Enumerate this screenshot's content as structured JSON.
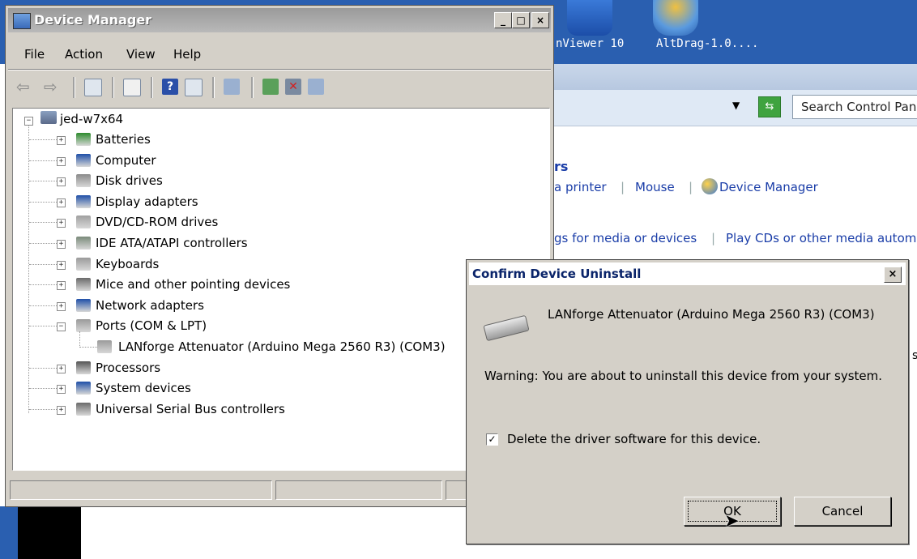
{
  "desktop": {
    "icons": [
      {
        "label": "nViewer 10",
        "icon": "viewer-app-icon"
      },
      {
        "label": "AltDrag-1.0....",
        "icon": "altdrag-app-icon"
      }
    ]
  },
  "control_panel": {
    "search_placeholder": "Search Control Pan",
    "go_icon": "go-arrow-icon",
    "section_fragment": "rs",
    "row1": [
      "a printer",
      "Mouse",
      "Device Manager"
    ],
    "row2": [
      "gs for media or devices",
      "Play CDs or other media autom"
    ],
    "edge_fragment": "s"
  },
  "device_manager": {
    "title": "Device Manager",
    "menu": [
      "File",
      "Action",
      "View",
      "Help"
    ],
    "tree": {
      "root": "jed-w7x64",
      "items": [
        {
          "label": "Batteries",
          "icon": "battery-icon",
          "color": "#2e8b2e"
        },
        {
          "label": "Computer",
          "icon": "computer-icon",
          "color": "#1f4fa8"
        },
        {
          "label": "Disk drives",
          "icon": "disk-drive-icon",
          "color": "#8a8a8a"
        },
        {
          "label": "Display adapters",
          "icon": "display-adapter-icon",
          "color": "#1f4fa8"
        },
        {
          "label": "DVD/CD-ROM drives",
          "icon": "dvd-drive-icon",
          "color": "#a0a0a0"
        },
        {
          "label": "IDE ATA/ATAPI controllers",
          "icon": "ide-controller-icon",
          "color": "#7a8a7a"
        },
        {
          "label": "Keyboards",
          "icon": "keyboard-icon",
          "color": "#9a9a9a"
        },
        {
          "label": "Mice and other pointing devices",
          "icon": "mouse-icon",
          "color": "#6a6a6a"
        },
        {
          "label": "Network adapters",
          "icon": "network-adapter-icon",
          "color": "#1f4fa8"
        },
        {
          "label": "Ports (COM & LPT)",
          "icon": "port-icon",
          "color": "#9a9a9a",
          "expanded": true
        },
        {
          "label": "LANforge Attenuator (Arduino Mega 2560 R3) (COM3)",
          "icon": "port-device-icon",
          "color": "#9a9a9a",
          "child": true
        },
        {
          "label": "Processors",
          "icon": "processor-icon",
          "color": "#555555"
        },
        {
          "label": "System devices",
          "icon": "system-devices-icon",
          "color": "#1f4fa8"
        },
        {
          "label": "Universal Serial Bus controllers",
          "icon": "usb-icon",
          "color": "#6a6a6a"
        }
      ]
    }
  },
  "dialog": {
    "title": "Confirm Device Uninstall",
    "device_name": "LANforge Attenuator (Arduino Mega 2560 R3) (COM3)",
    "warning": "Warning: You are about to uninstall this device from your system.",
    "checkbox_label": "Delete the driver software for this device.",
    "checkbox_checked": true,
    "ok_label": "OK",
    "cancel_label": "Cancel"
  }
}
